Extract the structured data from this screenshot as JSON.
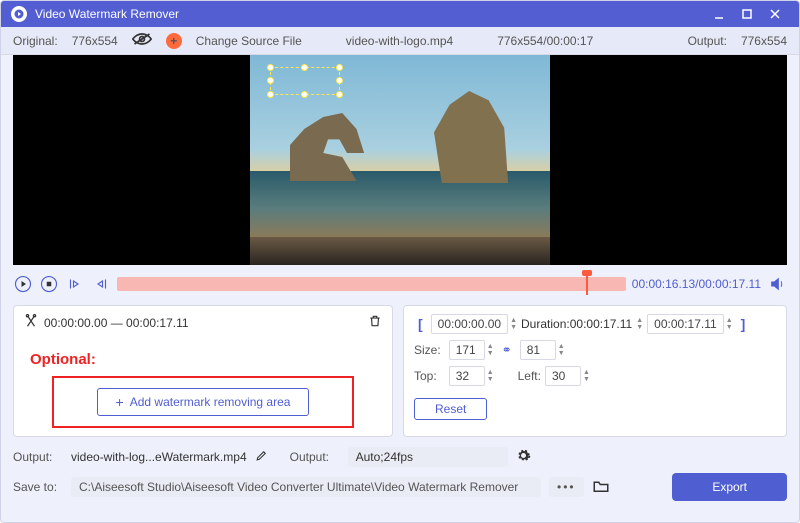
{
  "window": {
    "title": "Video Watermark Remover"
  },
  "infobar": {
    "original_label": "Original:",
    "original_value": "776x554",
    "change_source": "Change Source File",
    "filename": "video-with-logo.mp4",
    "src_info": "776x554/00:00:17",
    "output_label": "Output:",
    "output_value": "776x554"
  },
  "transport": {
    "timecode": "00:00:16.13/00:00:17.11"
  },
  "clip": {
    "range": "00:00:00.00 — 00:00:17.11"
  },
  "left_panel": {
    "optional": "Optional:",
    "add_area": "Add watermark removing area"
  },
  "right_panel": {
    "start": "00:00:00.00",
    "duration_label": "Duration:",
    "duration_value": "00:00:17.11",
    "end": "00:00:17.11",
    "size_label": "Size:",
    "size_w": "171",
    "size_h": "81",
    "top_label": "Top:",
    "top_v": "32",
    "left_label": "Left:",
    "left_v": "30",
    "reset": "Reset"
  },
  "footer": {
    "output_label": "Output:",
    "output_name": "video-with-log...eWatermark.mp4",
    "output_fmt_label": "Output:",
    "output_fmt": "Auto;24fps",
    "save_label": "Save to:",
    "save_path": "C:\\Aiseesoft Studio\\Aiseesoft Video Converter Ultimate\\Video Watermark Remover",
    "export": "Export"
  }
}
